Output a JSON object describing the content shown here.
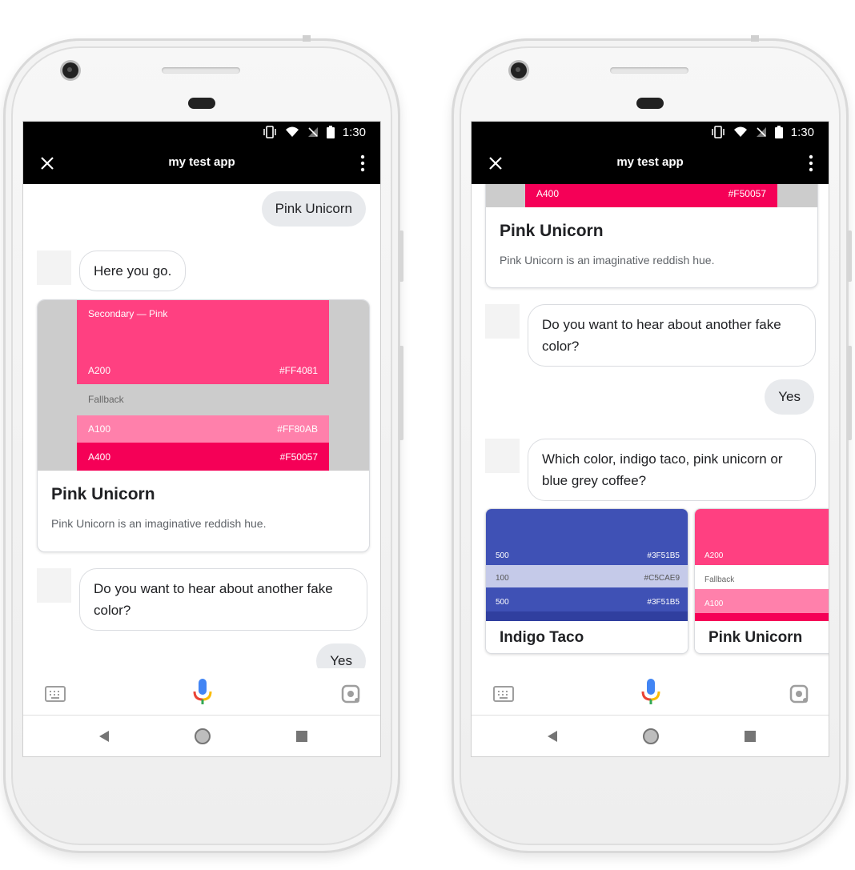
{
  "colors": {
    "pink_a200": "#FF4081",
    "pink_a100": "#FF80AB",
    "pink_a400": "#F50057",
    "indigo_500": "#3F51B5",
    "indigo_100": "#C5CAE9",
    "fallback_grey": "#CCCCCC"
  },
  "status_bar": {
    "time": "1:30",
    "icons": [
      "vibrate-icon",
      "wifi-icon",
      "no-signal-icon",
      "battery-icon"
    ]
  },
  "app_bar": {
    "title": "my test app",
    "close_icon": "close-icon",
    "menu_icon": "more-vert-icon"
  },
  "left_phone": {
    "user_message_1": "Pink Unicorn",
    "bot_message_1": "Here you go.",
    "card": {
      "swatch_header": "Secondary — Pink",
      "a200_label": "A200",
      "a200_hex": "#FF4081",
      "fallback_label": "Fallback",
      "a100_label": "A100",
      "a100_hex": "#FF80AB",
      "a400_label": "A400",
      "a400_hex": "#F50057",
      "title": "Pink Unicorn",
      "description": "Pink Unicorn is an imaginative reddish hue."
    },
    "bot_message_2": "Do you want to hear about another fake color?",
    "user_message_2": "Yes"
  },
  "right_phone": {
    "card_top": {
      "a400_label": "A400",
      "a400_hex": "#F50057",
      "title": "Pink Unicorn",
      "description": "Pink Unicorn is an imaginative reddish hue."
    },
    "bot_message_1": "Do you want to hear about another fake color?",
    "user_message_1": "Yes",
    "bot_message_2": "Which color, indigo taco, pink unicorn or blue grey coffee?",
    "carousel": [
      {
        "title": "Indigo Taco",
        "rows": [
          {
            "label": "500",
            "hex": "#3F51B5"
          },
          {
            "label": "100",
            "hex": "#C5CAE9"
          },
          {
            "label": "500",
            "hex": "#3F51B5"
          }
        ]
      },
      {
        "title": "Pink Unicorn",
        "rows": [
          {
            "label": "A200",
            "hex": ""
          },
          {
            "label": "Fallback",
            "hex": ""
          },
          {
            "label": "A100",
            "hex": ""
          }
        ]
      }
    ]
  },
  "input_bar": {
    "keyboard_icon": "keyboard-icon",
    "mic_icon": "mic-icon",
    "lens_icon": "lens-icon"
  },
  "nav_bar": {
    "back_icon": "back-icon",
    "home_icon": "home-icon",
    "recents_icon": "recents-icon"
  }
}
